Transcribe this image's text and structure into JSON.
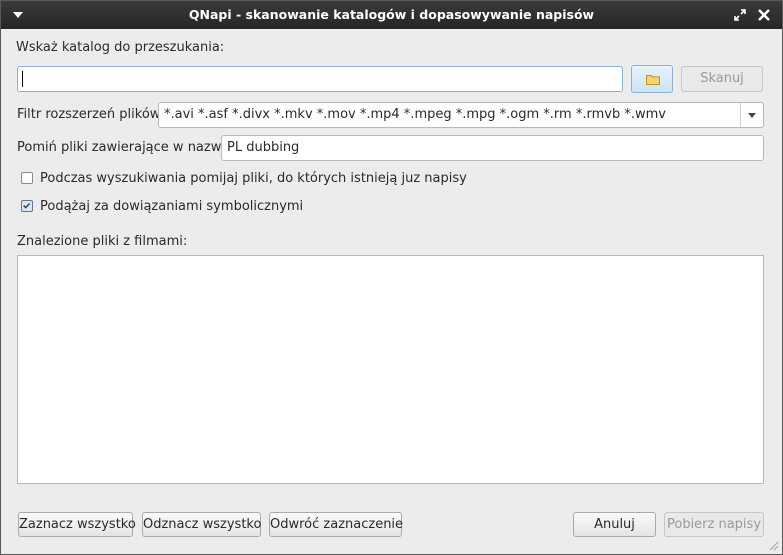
{
  "window": {
    "title": "QNapi - skanowanie katalogów i dopasowywanie napisów"
  },
  "directory": {
    "label": "Wskaż katalog do przeszukania:",
    "value": "",
    "scan_button": "Skanuj"
  },
  "filter": {
    "label": "Filtr rozszerzeń plików:",
    "value": "*.avi *.asf *.divx *.mkv *.mov *.mp4 *.mpeg *.mpg *.ogm *.rm *.rmvb *.wmv"
  },
  "skip": {
    "label": "Pomiń pliki zawierające w nazwie:",
    "value": "PL dubbing"
  },
  "options": {
    "skip_existing": {
      "label": "Podczas wyszukiwania pomijaj pliki, do których istnieją juz napisy",
      "checked": false
    },
    "follow_symlinks": {
      "label": "Podążaj za dowiązaniami symbolicznymi",
      "checked": true
    }
  },
  "found": {
    "label": "Znalezione pliki z filmami:",
    "items": []
  },
  "buttons": {
    "select_all": "Zaznacz wszystko",
    "deselect_all": "Odznacz wszystko",
    "invert": "Odwróć zaznaczenie",
    "cancel": "Anuluj",
    "download": "Pobierz napisy"
  },
  "colors": {
    "titlebar": "#2e2e2e",
    "window_bg": "#ececec",
    "accent": "#8fb3d6"
  }
}
